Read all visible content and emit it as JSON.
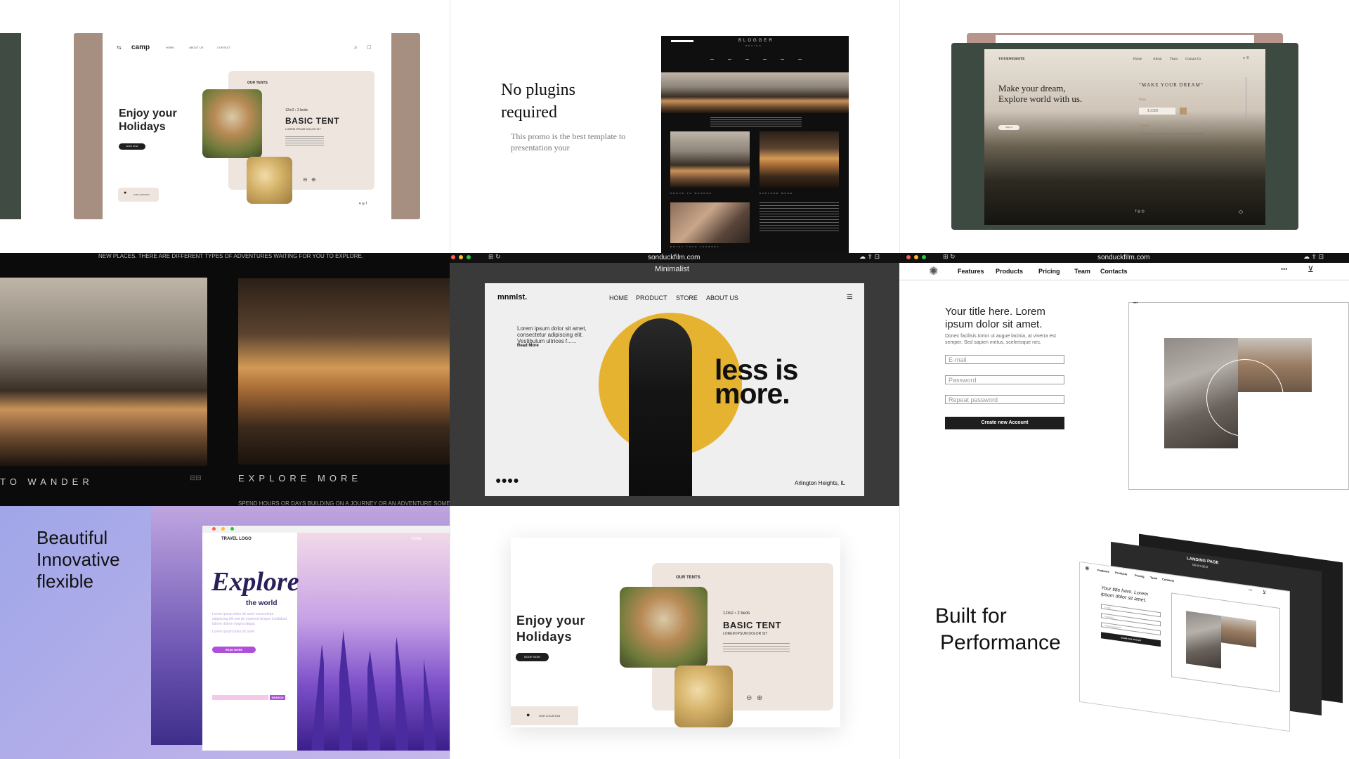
{
  "tile1": {
    "logo": "camp",
    "nav": [
      "HOME",
      "ABOUT US",
      "CONTACT"
    ],
    "headline": "Enjoy your Holidays",
    "cta": "BOOK NOW",
    "section": "OUR TENTS",
    "specs": "12m2  ›  2 beds",
    "product_title": "BASIC TENT",
    "product_sub": "LOREM IPSUM DOLOR SIT",
    "location": "OUR LOCATION"
  },
  "tile2": {
    "headline": "No plugins required",
    "body": "This promo is the best template to presentation your",
    "blog_title": "BLOGGER",
    "blog_sub": "DESIGN",
    "captions": [
      "PROUD TO WANDER",
      "EXPLORE MORE",
      "ENJOY YOUR JOURNEY"
    ]
  },
  "tile3": {
    "logo": "YOURWEBSITE",
    "nav": [
      "Home",
      "About",
      "Team",
      "Contact Us"
    ],
    "headline": "Make your dream, Explore world with us.",
    "quote": "\"MAKE YOUR DREAM\"",
    "price_label": "Price",
    "price": "$ 2300",
    "country_label": "Country",
    "bullets": [
      "Lorem ipsum dolor sit amet, consectetur adipiscing",
      "Lorem ipsum dolor sit amet, consectetur adipiscing"
    ],
    "signin": "Sign In"
  },
  "tile4": {
    "top_text": "NEW PLACES. THERE ARE DIFFERENT TYPES OF ADVENTURES WAITING FOR YOU TO EXPLORE.",
    "left_caption": "TO WANDER",
    "right_caption": "EXPLORE MORE",
    "bottom_text": "SPEND HOURS OR DAYS BUILDING ON A JOURNEY OR AN ADVENTURE SOMEWHERE BY YA"
  },
  "tile5": {
    "url": "sonduckfilm.com",
    "window_title": "Minimalist",
    "logo": "mnmlst.",
    "nav": [
      "HOME",
      "PRODUCT",
      "STORE",
      "ABOUT US"
    ],
    "intro": "Lorem ipsum dolor sit amet, consectetur adipiscing elit. Vestibulum ultrices f......",
    "read_more": "Read More",
    "headline_1": "less is",
    "headline_2": "more.",
    "location": "Arlington Heights, IL",
    "accent": "#e6b331"
  },
  "tile6": {
    "url": "sonduckfilm.com",
    "nav": [
      "Features",
      "Products",
      "Pricing",
      "Team",
      "Contacts"
    ],
    "title": "Your title here. Lorem ipsum dolor sit amet.",
    "body": "Donec facilisis tortor ut augue lacinia, at viverra est semper. Sed sapien metus, scelerisque nec.",
    "fields": [
      "E-mail",
      "Password",
      "Repeat password"
    ],
    "submit": "Create new Account"
  },
  "tile7": {
    "headline": "Beautiful Innovative flexible",
    "logo": "TRAVEL LOGO",
    "nav": "HOME",
    "explore": "Explore",
    "explore_sub": "the world",
    "body": "Lorem ipsum dolor sit amet consectetur adipiscing elit sed do eiusmod tempor incididunt labore dolore magna aliqua",
    "body2": "Lorem ipsum dolor sit amet",
    "cta": "READ MORE",
    "search": "SEARCH"
  },
  "tile8": {
    "headline": "Enjoy your Holidays",
    "cta": "BOOK NOW",
    "section": "OUR TENTS",
    "specs": "12m2  ›  2 beds",
    "product_title": "BASIC TENT",
    "product_sub": "LOREM IPSUM DOLOR SIT",
    "location": "OUR LOCATION"
  },
  "tile9": {
    "headline_1": "Built for",
    "headline_2": "Performance",
    "page_title": "LANDING PAGE",
    "page_sub": "Minimalist",
    "nav": [
      "Features",
      "Products",
      "Pricing",
      "Team",
      "Contacts"
    ],
    "title": "Your title here. Lorem ipsum dolor sit amet.",
    "fields": [
      "E-mail",
      "Password",
      "Repeat password"
    ],
    "submit": "Create new Account"
  }
}
